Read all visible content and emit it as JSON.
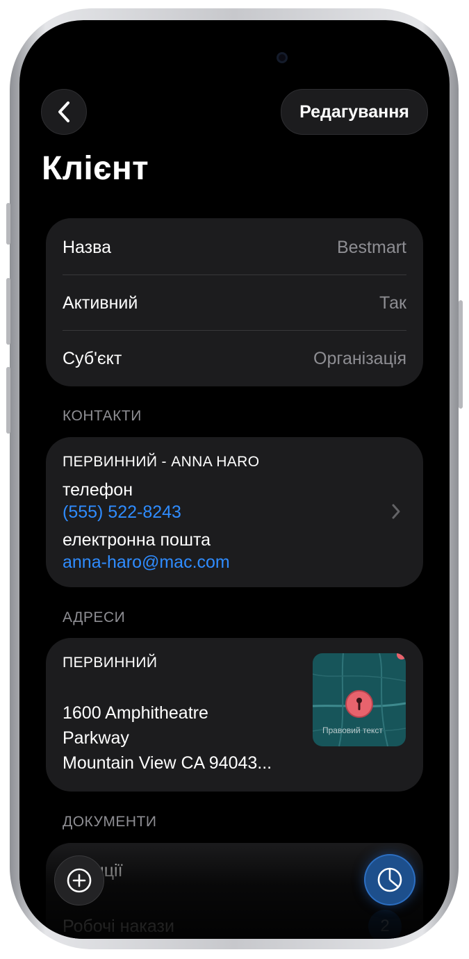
{
  "header": {
    "back_icon": "chevron-left-icon",
    "edit_label": "Редагування",
    "title": "Клієнт"
  },
  "details": {
    "rows": [
      {
        "label": "Назва",
        "value": "Bestmart"
      },
      {
        "label": "Активний",
        "value": "Так"
      },
      {
        "label": "Суб'єкт",
        "value": "Організація"
      }
    ]
  },
  "contacts": {
    "header": "КОНТАКТИ",
    "primary_label": "ПЕРВИННИЙ - ANNA HARO",
    "phone_label": "телефон",
    "phone_value": "(555) 522-8243",
    "email_label": "електронна пошта",
    "email_value": "anna-haro@mac.com"
  },
  "addresses": {
    "header": "АДРЕСИ",
    "primary_label": "ПЕРВИННИЙ",
    "lines": [
      "1600 Amphitheatre",
      "Parkway",
      "Mountain View CA 94043..."
    ],
    "map_legal_text": "Правовий текст"
  },
  "documents": {
    "header": "ДОКУМЕНТИ",
    "items": [
      {
        "label": "...танції",
        "count": ""
      },
      {
        "label": "Робочі накази",
        "count": "2"
      }
    ]
  },
  "fabs": {
    "add_icon": "plus-circle-icon",
    "stats_icon": "pie-chart-icon"
  },
  "colors": {
    "background": "#000000",
    "card": "#1c1c1e",
    "link": "#2f8cff",
    "secondary_text": "#8e8e93",
    "map_pin": "#e8636d",
    "accent_fab": "#1d4f8c"
  }
}
